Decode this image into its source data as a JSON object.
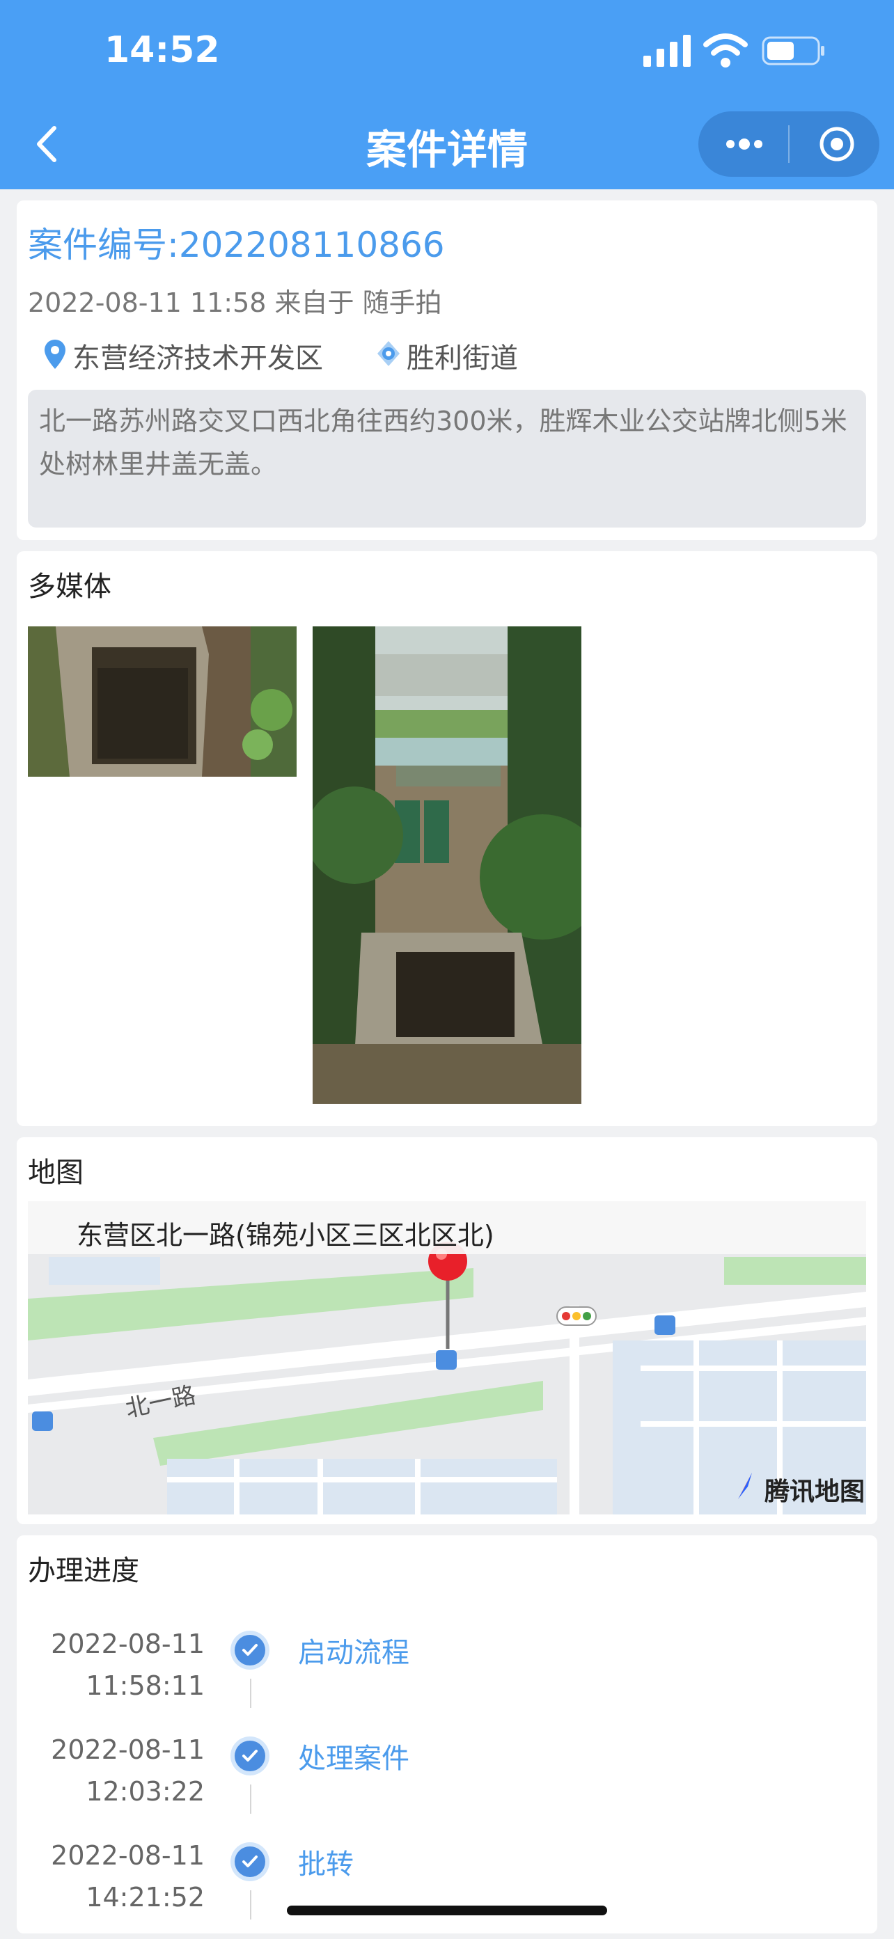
{
  "status_bar": {
    "time": "14:52"
  },
  "nav": {
    "title": "案件详情"
  },
  "case": {
    "number_label": "案件编号:202208110866",
    "meta": "2022-08-11 11:58 来自于 随手拍",
    "district": "东营经济技术开发区",
    "street": "胜利街道",
    "description": "北一路苏州路交叉口西北角往西约300米，胜辉木业公交站牌北侧5米处树林里井盖无盖。"
  },
  "media": {
    "title": "多媒体"
  },
  "map": {
    "title": "地图",
    "address": "东营区北一路(锦苑小区三区北区北)",
    "road_label": "北一路",
    "provider": "腾讯地图"
  },
  "progress": {
    "title": "办理进度",
    "steps": [
      {
        "date": "2022-08-11",
        "time": "11:58:11",
        "name": "启动流程"
      },
      {
        "date": "2022-08-11",
        "time": "12:03:22",
        "name": "处理案件"
      },
      {
        "date": "2022-08-11",
        "time": "14:21:52",
        "name": "批转"
      }
    ]
  },
  "colors": {
    "nav_bg": "#4a9ff5",
    "accent": "#4b9bec"
  }
}
